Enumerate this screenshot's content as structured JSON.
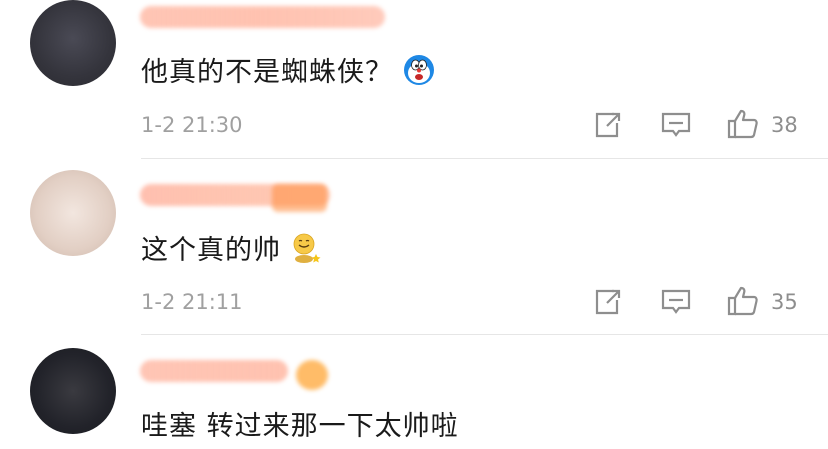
{
  "comments": [
    {
      "text": "他真的不是蜘蛛侠？",
      "time": "1-2 21:30",
      "likes": "38",
      "emoji_icon": "doraemon-face-icon"
    },
    {
      "text": "这个真的帅",
      "time": "1-2 21:11",
      "likes": "35",
      "emoji_icon": "sitting-smile-emoji-icon"
    },
    {
      "text": "哇塞 转过来那一下太帅啦"
    }
  ],
  "icons": {
    "share": "share-icon",
    "reply": "comment-icon",
    "like": "thumbs-up-icon"
  },
  "colors": {
    "text": "#1a1a1a",
    "meta": "#a0a0a0",
    "icon": "#8e8e8e",
    "divider": "#e6e6e6"
  }
}
